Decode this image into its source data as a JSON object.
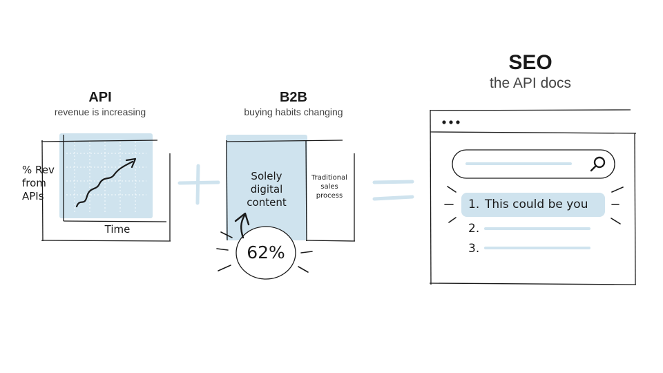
{
  "api": {
    "title": "API",
    "subtitle": "revenue is increasing",
    "y_label": "% Rev from APIs",
    "x_label": "Time"
  },
  "b2b": {
    "title": "B2B",
    "subtitle": "buying habits changing",
    "digital_label": "Solely digital content",
    "traditional_label": "Traditional sales process",
    "stat": "62%"
  },
  "seo": {
    "title": "SEO",
    "subtitle": "the API docs",
    "results": [
      {
        "number": "1.",
        "text": "This could be you"
      },
      {
        "number": "2.",
        "text": ""
      },
      {
        "number": "3.",
        "text": ""
      }
    ]
  },
  "colors": {
    "highlight": "#cfe3ee",
    "stroke": "#1a1a1a",
    "operator": "#cfe3ee"
  },
  "icons": [
    "plus-icon",
    "equals-icon",
    "search-icon",
    "arrow-up-icon",
    "window-dots-icon"
  ]
}
